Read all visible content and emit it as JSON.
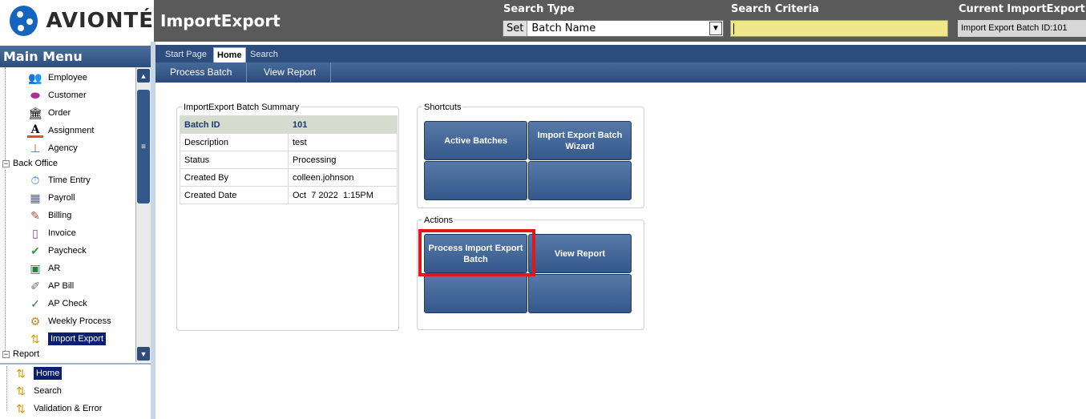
{
  "header": {
    "logo_text": "AVIONTÉ",
    "app_title": "ImportExport",
    "search_type_label": "Search Type",
    "set_label": "Set",
    "search_type_value": "Batch Name",
    "search_criteria_label": "Search Criteria",
    "search_criteria_value": "",
    "current_label": "Current ImportExport",
    "current_value": "Import Export Batch ID:101"
  },
  "menu": {
    "title": "Main Menu",
    "items": [
      {
        "label": "Employee",
        "icon": "employee-icon"
      },
      {
        "label": "Customer",
        "icon": "customer-icon"
      },
      {
        "label": "Order",
        "icon": "order-icon"
      },
      {
        "label": "Assignment",
        "icon": "assignment-icon"
      },
      {
        "label": "Agency",
        "icon": "agency-icon"
      }
    ],
    "back_office_label": "Back Office",
    "back_office_items": [
      {
        "label": "Time Entry",
        "icon": "time-entry-icon"
      },
      {
        "label": "Payroll",
        "icon": "payroll-icon"
      },
      {
        "label": "Billing",
        "icon": "billing-icon"
      },
      {
        "label": "Invoice",
        "icon": "invoice-icon"
      },
      {
        "label": "Paycheck",
        "icon": "paycheck-icon"
      },
      {
        "label": "AR",
        "icon": "ar-icon"
      },
      {
        "label": "AP Bill",
        "icon": "ap-bill-icon"
      },
      {
        "label": "AP Check",
        "icon": "ap-check-icon"
      },
      {
        "label": "Weekly Process",
        "icon": "weekly-process-icon"
      },
      {
        "label": "Import Export",
        "icon": "import-export-icon"
      }
    ],
    "report_label": "Report"
  },
  "subtree": {
    "items": [
      {
        "label": "Home"
      },
      {
        "label": "Search"
      },
      {
        "label": "Validation & Error"
      }
    ]
  },
  "tabs": [
    {
      "label": "Start Page"
    },
    {
      "label": "Home"
    },
    {
      "label": "Search"
    }
  ],
  "toolbar": {
    "process_batch": "Process Batch",
    "view_report": "View Report"
  },
  "summary": {
    "title": "ImportExport Batch Summary",
    "rows": [
      {
        "label": "Batch ID",
        "value": "101"
      },
      {
        "label": "Description",
        "value": "test"
      },
      {
        "label": "Status",
        "value": "Processing"
      },
      {
        "label": "Created By",
        "value": "colleen.johnson"
      },
      {
        "label": "Created Date",
        "value": "Oct  7 2022  1:15PM"
      }
    ]
  },
  "shortcuts": {
    "title": "Shortcuts",
    "active_batches": "Active Batches",
    "wizard": "Import Export Batch Wizard"
  },
  "actions": {
    "title": "Actions",
    "process": "Process Import Export Batch",
    "view_report": "View Report"
  }
}
